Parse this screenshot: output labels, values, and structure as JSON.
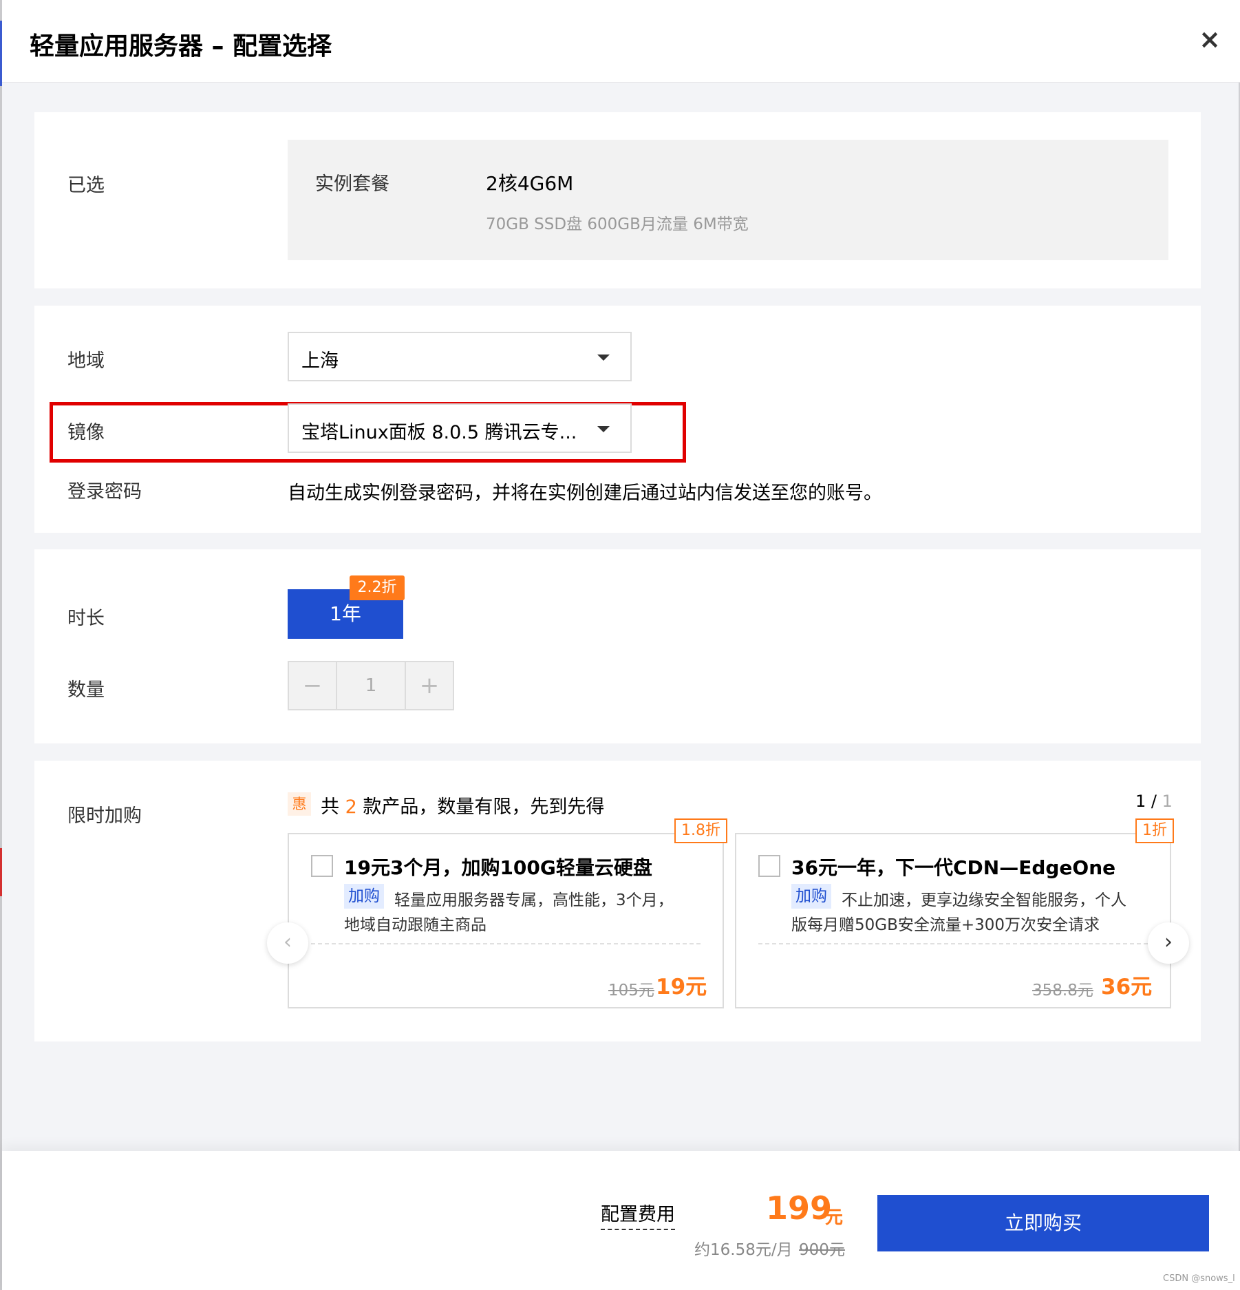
{
  "dialog": {
    "title": "轻量应用服务器 – 配置选择",
    "close_icon": "×"
  },
  "selected": {
    "label": "已选",
    "package_label": "实例套餐",
    "package_value": "2核4G6M",
    "package_spec": "70GB SSD盘 600GB月流量 6M带宽"
  },
  "config": {
    "region_label": "地域",
    "region_value": "上海",
    "image_label": "镜像",
    "image_value": "宝塔Linux面板 8.0.5 腾讯云专...",
    "password_label": "登录密码",
    "password_text": "自动生成实例登录密码，并将在实例创建后通过站内信发送至您的账号。"
  },
  "purchase": {
    "duration_label": "时长",
    "duration_value": "1年",
    "discount_badge": "2.2折",
    "quantity_label": "数量",
    "quantity_value": "1",
    "minus_glyph": "−",
    "plus_glyph": "+"
  },
  "promo": {
    "label": "限时加购",
    "hui": "惠",
    "text_prefix": "共",
    "count": "2",
    "text_suffix": "款产品，数量有限，先到先得",
    "page_current": "1 /",
    "page_total": "1",
    "prev_glyph": "‹",
    "next_glyph": "›",
    "products": [
      {
        "tag": "1.8折",
        "title": "19元3个月，加购100G轻量云硬盘",
        "badge": "加购",
        "desc_line1": "轻量应用服务器专属，高性能，3个月，",
        "desc_line2": "地域自动跟随主商品",
        "old_price": "105元",
        "new_price": "19元"
      },
      {
        "tag": "1折",
        "title": "36元一年，下一代CDN—EdgeOne",
        "badge": "加购",
        "desc_line1": "不止加速，更享边缘安全智能服务，个人",
        "desc_line2": "版每月赠50GB安全流量+300万次安全请求",
        "old_price": "358.8元",
        "new_price": "36元"
      }
    ]
  },
  "footer": {
    "fee_label": "配置费用",
    "amount": "199",
    "unit": "元",
    "monthly": "约16.58元/月",
    "original": "900元",
    "buy_label": "立即购买"
  },
  "watermark": "CSDN @snows_l",
  "colors": {
    "primary": "#1f4fd0",
    "accent": "#ff7a1a",
    "highlight_border": "#e00000"
  }
}
